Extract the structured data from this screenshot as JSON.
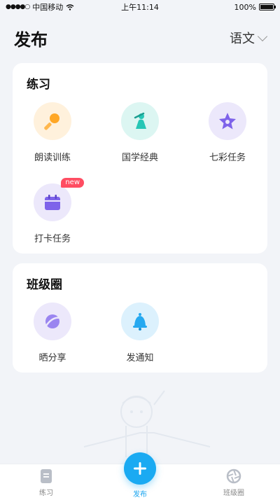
{
  "status_bar": {
    "carrier": "中国移动",
    "time": "上午11:14",
    "battery": "100%"
  },
  "header": {
    "title": "发布",
    "subject": "语文"
  },
  "practice": {
    "title": "练习",
    "items": [
      {
        "label": "朗读训练",
        "icon": "microphone-icon",
        "color": "#ffa726"
      },
      {
        "label": "国学经典",
        "icon": "scholar-figure-icon",
        "color": "#26c6b5"
      },
      {
        "label": "七彩任务",
        "icon": "star-icon",
        "color": "#7e63ea"
      },
      {
        "label": "打卡任务",
        "icon": "calendar-icon",
        "color": "#7e63ea",
        "badge": "new"
      }
    ]
  },
  "class_circle": {
    "title": "班级圈",
    "items": [
      {
        "label": "晒分享",
        "icon": "planet-icon",
        "color": "#7e63ea"
      },
      {
        "label": "发通知",
        "icon": "bell-icon",
        "color": "#26a9f0"
      }
    ]
  },
  "tabbar": {
    "items": [
      {
        "label": "练习",
        "icon": "document-icon",
        "active": false
      },
      {
        "label": "发布",
        "icon": "plus-icon",
        "active": true
      },
      {
        "label": "班级圈",
        "icon": "aperture-icon",
        "active": false
      }
    ],
    "accent": "#1aa5f0"
  }
}
